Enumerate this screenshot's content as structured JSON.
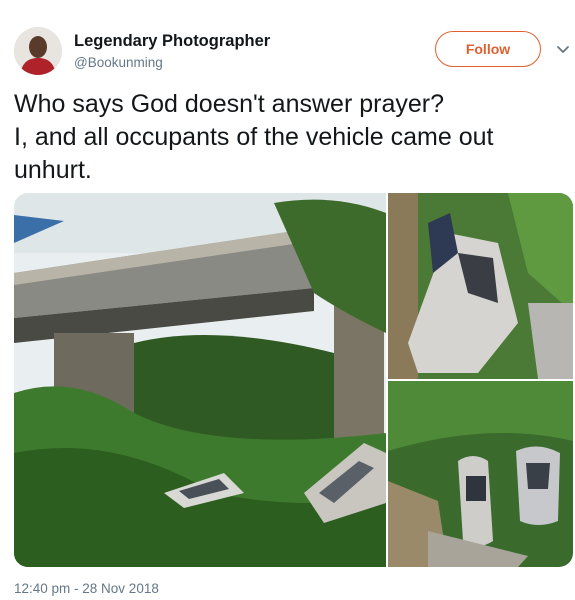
{
  "user": {
    "display_name": "Legendary Photographer",
    "handle": "@Bookunming",
    "avatar_icon": "profile-photo"
  },
  "follow_label": "Follow",
  "menu_icon": "chevron-down-icon",
  "tweet": {
    "lines": [
      "Who says God doesn't answer prayer?",
      "I, and all occupants of the vehicle came out",
      "unhurt."
    ],
    "timestamp": "12:40 pm - 28 Nov 2018"
  },
  "colors": {
    "accent": "#e0602f",
    "text": "#14171a",
    "secondary": "#657786"
  }
}
